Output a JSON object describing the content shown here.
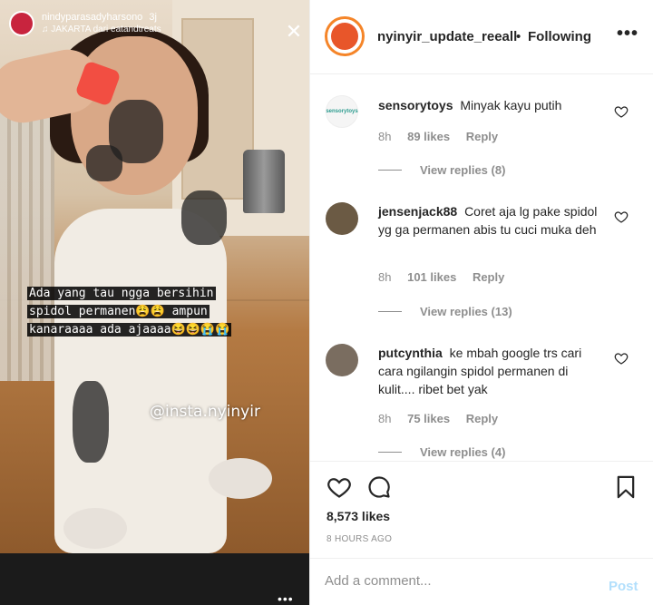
{
  "story": {
    "username": "nindyparasadyharsono",
    "time": "3j",
    "location": "JAKARTA dari eatandtreats",
    "caption_lines": [
      "Ada yang tau ngga bersihin",
      "spidol permanen😩😩 ampun",
      "kanaraaaa ada ajaaaa😆😆😭😭"
    ],
    "watermark": "@insta.nyinyir",
    "close_icon": "close-icon",
    "more": "•••"
  },
  "header": {
    "username": "nyinyir_update_reeall",
    "separator": "•",
    "follow_status": "Following",
    "more": "•••"
  },
  "comments": [
    {
      "username": "sensorytoys",
      "text": "Minyak kayu putih",
      "time": "8h",
      "likes": "89 likes",
      "reply": "Reply",
      "view_replies": "View replies (8)",
      "avatar_color": "#f5f5f5"
    },
    {
      "username": "jensenjack88",
      "text": "Coret aja lg pake spidol yg ga permanen abis tu cuci muka deh",
      "time": "8h",
      "likes": "101 likes",
      "reply": "Reply",
      "view_replies": "View replies (13)",
      "avatar_color": "#6b5a44"
    },
    {
      "username": "putcynthia",
      "text": "ke mbah google trs cari cara ngilangin spidol permanen di kulit.... ribet bet yak",
      "time": "8h",
      "likes": "75 likes",
      "reply": "Reply",
      "view_replies": "View replies (4)",
      "avatar_color": "#7a6d60"
    }
  ],
  "post": {
    "likes": "8,573 likes",
    "time_ago": "8 HOURS AGO"
  },
  "add_comment": {
    "placeholder": "Add a comment...",
    "post_label": "Post"
  },
  "colors": {
    "link_disabled": "#b2dffc",
    "muted": "#8e8e8e",
    "text": "#262626",
    "avatar_ring": "#f58529"
  }
}
